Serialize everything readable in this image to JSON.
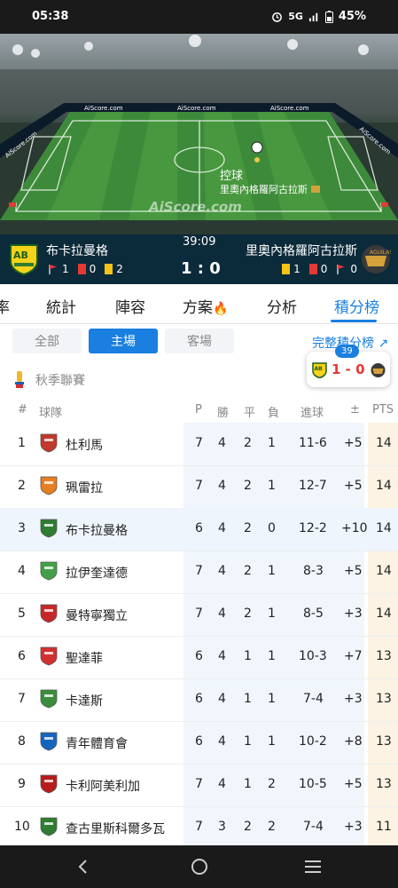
{
  "status": {
    "time": "05:38",
    "network": "5G",
    "battery": "45%"
  },
  "pitch": {
    "watermark": "AiScore.com",
    "board_texts": [
      "AiScore.com",
      "AiScore.com",
      "AiScore.com",
      "AiScore.com",
      "AiScore.com"
    ],
    "event_label": "控球",
    "event_team": "里奧內格羅阿古拉斯"
  },
  "match": {
    "home_name": "布卡拉曼格",
    "away_name": "里奧內格羅阿古拉斯",
    "minute": "39:09",
    "score": "1 : 0",
    "home_stats": {
      "corners": "1",
      "red": "0",
      "yellow": "2"
    },
    "away_stats": {
      "yellow": "1",
      "red": "0",
      "corners": "0"
    }
  },
  "tabs": [
    {
      "label": "率"
    },
    {
      "label": "統計"
    },
    {
      "label": "陣容"
    },
    {
      "label": "方案"
    },
    {
      "label": "分析"
    },
    {
      "label": "積分榜",
      "active": true
    }
  ],
  "filters": {
    "all": "全部",
    "home": "主場",
    "away": "客場",
    "active": "home"
  },
  "full_table_link": "完整積分榜",
  "floating": {
    "minute": "39",
    "score": "1 - 0"
  },
  "league_name": "秋季聯賽",
  "table_headers": {
    "rank": "#",
    "team": "球隊",
    "p": "P",
    "w": "勝",
    "d": "平",
    "l": "負",
    "goals": "進球",
    "diff": "±",
    "pts": "PTS"
  },
  "standings": [
    {
      "rank": "1",
      "team": "杜利馬",
      "p": "7",
      "w": "4",
      "d": "2",
      "l": "1",
      "goals": "11-6",
      "diff": "+5",
      "pts": "14",
      "crest_color": "#c0392b"
    },
    {
      "rank": "2",
      "team": "珮雷拉",
      "p": "7",
      "w": "4",
      "d": "2",
      "l": "1",
      "goals": "12-7",
      "diff": "+5",
      "pts": "14",
      "crest_color": "#e67e22"
    },
    {
      "rank": "3",
      "team": "布卡拉曼格",
      "p": "6",
      "w": "4",
      "d": "2",
      "l": "0",
      "goals": "12-2",
      "diff": "+10",
      "pts": "14",
      "crest_color": "#2e7d32",
      "highlight": true
    },
    {
      "rank": "4",
      "team": "拉伊奎達德",
      "p": "7",
      "w": "4",
      "d": "2",
      "l": "1",
      "goals": "8-3",
      "diff": "+5",
      "pts": "14",
      "crest_color": "#43a047"
    },
    {
      "rank": "5",
      "team": "曼特寧獨立",
      "p": "7",
      "w": "4",
      "d": "2",
      "l": "1",
      "goals": "8-5",
      "diff": "+3",
      "pts": "14",
      "crest_color": "#c62828"
    },
    {
      "rank": "6",
      "team": "聖達菲",
      "p": "6",
      "w": "4",
      "d": "1",
      "l": "1",
      "goals": "10-3",
      "diff": "+7",
      "pts": "13",
      "crest_color": "#d32f2f"
    },
    {
      "rank": "7",
      "team": "卡達斯",
      "p": "6",
      "w": "4",
      "d": "1",
      "l": "1",
      "goals": "7-4",
      "diff": "+3",
      "pts": "13",
      "crest_color": "#388e3c"
    },
    {
      "rank": "8",
      "team": "青年體育會",
      "p": "6",
      "w": "4",
      "d": "1",
      "l": "1",
      "goals": "10-2",
      "diff": "+8",
      "pts": "13",
      "crest_color": "#1565c0"
    },
    {
      "rank": "9",
      "team": "卡利阿美利加",
      "p": "7",
      "w": "4",
      "d": "1",
      "l": "2",
      "goals": "10-5",
      "diff": "+5",
      "pts": "13",
      "crest_color": "#b71c1c"
    },
    {
      "rank": "10",
      "team": "查古里斯科爾多瓦",
      "p": "7",
      "w": "3",
      "d": "2",
      "l": "2",
      "goals": "7-4",
      "diff": "+3",
      "pts": "11",
      "crest_color": "#2e7d32"
    }
  ],
  "nav": {
    "back": "back-icon",
    "home": "home-icon",
    "menu": "menu-icon"
  }
}
